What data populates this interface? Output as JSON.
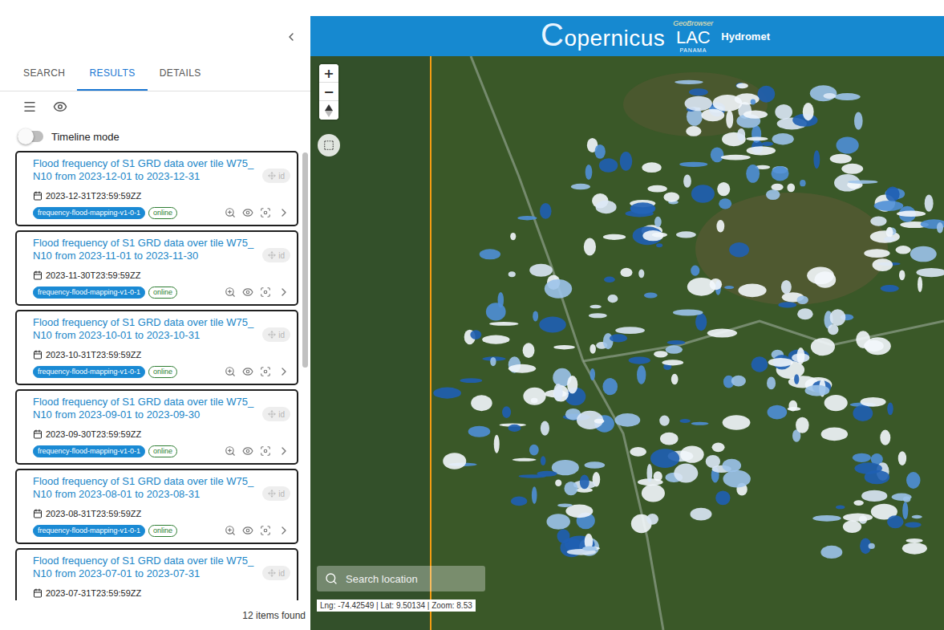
{
  "sidebar": {
    "tabs": [
      {
        "label": "SEARCH",
        "selected": false
      },
      {
        "label": "RESULTS",
        "selected": true
      },
      {
        "label": "DETAILS",
        "selected": false
      }
    ],
    "timeline_mode": {
      "label": "Timeline mode",
      "on": false
    },
    "results": [
      {
        "title": "Flood frequency of S1 GRD data over tile W75_N10 from 2023-12-01 to 2023-12-31",
        "id_chip": "id",
        "id_disabled": true,
        "datetime": "2023-12-31T23:59:59ZZ",
        "tags": [
          {
            "label": "frequency-flood-mapping-v1-0-1",
            "kind": "collection"
          },
          {
            "label": "online",
            "kind": "status"
          }
        ]
      },
      {
        "title": "Flood frequency of S1 GRD data over tile W75_N10 from 2023-11-01 to 2023-11-30",
        "id_chip": "id",
        "id_disabled": true,
        "datetime": "2023-11-30T23:59:59ZZ",
        "tags": [
          {
            "label": "frequency-flood-mapping-v1-0-1",
            "kind": "collection"
          },
          {
            "label": "online",
            "kind": "status"
          }
        ]
      },
      {
        "title": "Flood frequency of S1 GRD data over tile W75_N10 from 2023-10-01 to 2023-10-31",
        "id_chip": "id",
        "id_disabled": true,
        "datetime": "2023-10-31T23:59:59ZZ",
        "tags": [
          {
            "label": "frequency-flood-mapping-v1-0-1",
            "kind": "collection"
          },
          {
            "label": "online",
            "kind": "status"
          }
        ]
      },
      {
        "title": "Flood frequency of S1 GRD data over tile W75_N10 from 2023-09-01 to 2023-09-30",
        "id_chip": "id",
        "id_disabled": true,
        "datetime": "2023-09-30T23:59:59ZZ",
        "tags": [
          {
            "label": "frequency-flood-mapping-v1-0-1",
            "kind": "collection"
          },
          {
            "label": "online",
            "kind": "status"
          }
        ]
      },
      {
        "title": "Flood frequency of S1 GRD data over tile W75_N10 from 2023-08-01 to 2023-08-31",
        "id_chip": "id",
        "id_disabled": true,
        "datetime": "2023-08-31T23:59:59ZZ",
        "tags": [
          {
            "label": "frequency-flood-mapping-v1-0-1",
            "kind": "collection"
          },
          {
            "label": "online",
            "kind": "status"
          }
        ]
      },
      {
        "title": "Flood frequency of S1 GRD data over tile W75_N10 from 2023-07-01 to 2023-07-31",
        "id_chip": "id",
        "id_disabled": true,
        "datetime": "2023-07-31T23:59:59ZZ",
        "tags": []
      }
    ],
    "count": "12 items found"
  },
  "map": {
    "header": {
      "product": "GeoBrowser",
      "brand": "Copernicus",
      "region": "LAC",
      "country": "PANAMA",
      "app": "Hydromet"
    },
    "zoom_controls": [
      "+",
      "−"
    ],
    "search": {
      "placeholder": "Search location"
    },
    "status": "Lng: -74.42549 | Lat: 9.50134 | Zoom: 8.53"
  }
}
